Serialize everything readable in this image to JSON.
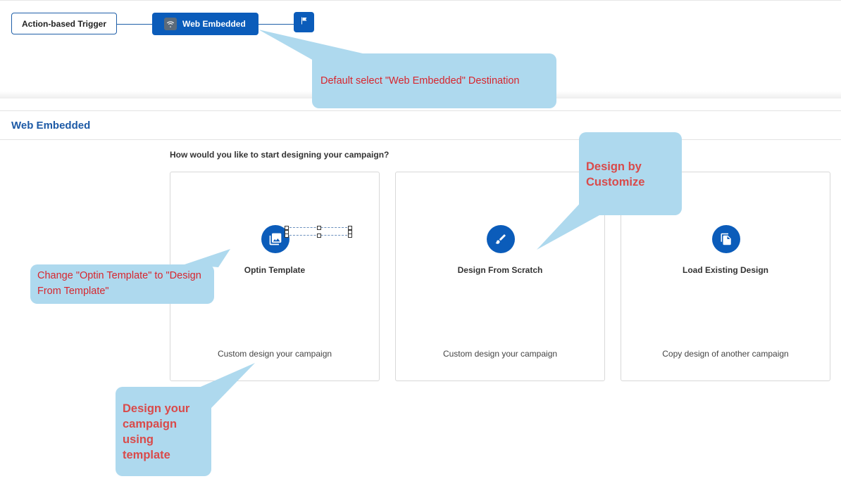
{
  "flow": {
    "trigger_label": "Action-based Trigger",
    "destination_label": "Web Embedded"
  },
  "section": {
    "title": "Web Embedded",
    "question": "How would you like to start designing your campaign?"
  },
  "options": [
    {
      "title": "Optin Template",
      "desc": "Custom design your campaign",
      "icon": "image-gallery-icon"
    },
    {
      "title": "Design From Scratch",
      "desc": "Custom design your campaign",
      "icon": "paint-brush-icon"
    },
    {
      "title": "Load Existing Design",
      "desc": "Copy design of another campaign",
      "icon": "copy-icon"
    }
  ],
  "annotations": {
    "default_destination": "Default select \"Web Embedded\" Destination",
    "design_by_customize": "Design by Customize",
    "rename_template": "Change \"Optin Template\" to \"Design From Template\"",
    "design_using_template": "Design your campaign using template"
  },
  "colors": {
    "brand_blue": "#0b5cba",
    "callout_bg": "#aed9ee",
    "callout_text": "#d7262e"
  }
}
